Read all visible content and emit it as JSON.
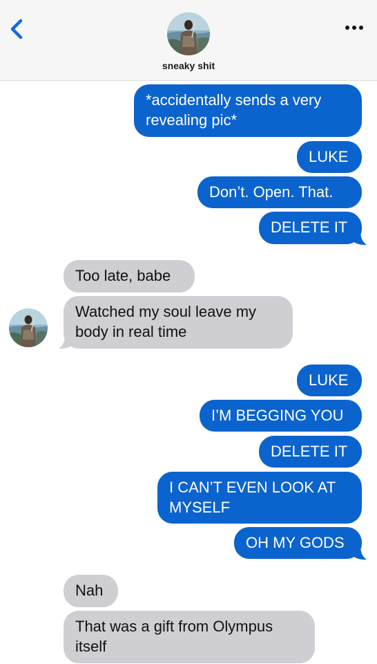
{
  "header": {
    "contact_name": "sneaky shit",
    "back_icon": "chevron-left-icon",
    "more_icon": "ellipsis-icon"
  },
  "colors": {
    "outgoing_bubble": "#0b63ce",
    "incoming_bubble": "#cfcfd3",
    "back_chevron": "#1769d9"
  },
  "messages": [
    {
      "direction": "outgoing",
      "text": "*accidentally sends a very revealing pic*"
    },
    {
      "direction": "outgoing",
      "text": "LUKE"
    },
    {
      "direction": "outgoing",
      "text": "Don’t. Open. That."
    },
    {
      "direction": "outgoing",
      "text": "DELETE IT"
    },
    {
      "direction": "incoming",
      "text": "Too late, babe"
    },
    {
      "direction": "incoming",
      "text": "Watched my soul leave my body in real time"
    },
    {
      "direction": "outgoing",
      "text": "LUKE"
    },
    {
      "direction": "outgoing",
      "text": "I’M BEGGING YOU"
    },
    {
      "direction": "outgoing",
      "text": "DELETE IT"
    },
    {
      "direction": "outgoing",
      "text": "I CAN’T EVEN LOOK AT MYSELF"
    },
    {
      "direction": "outgoing",
      "text": "OH MY GODS"
    },
    {
      "direction": "incoming",
      "text": "Nah"
    },
    {
      "direction": "incoming",
      "text": "That was a gift from Olympus itself"
    }
  ]
}
